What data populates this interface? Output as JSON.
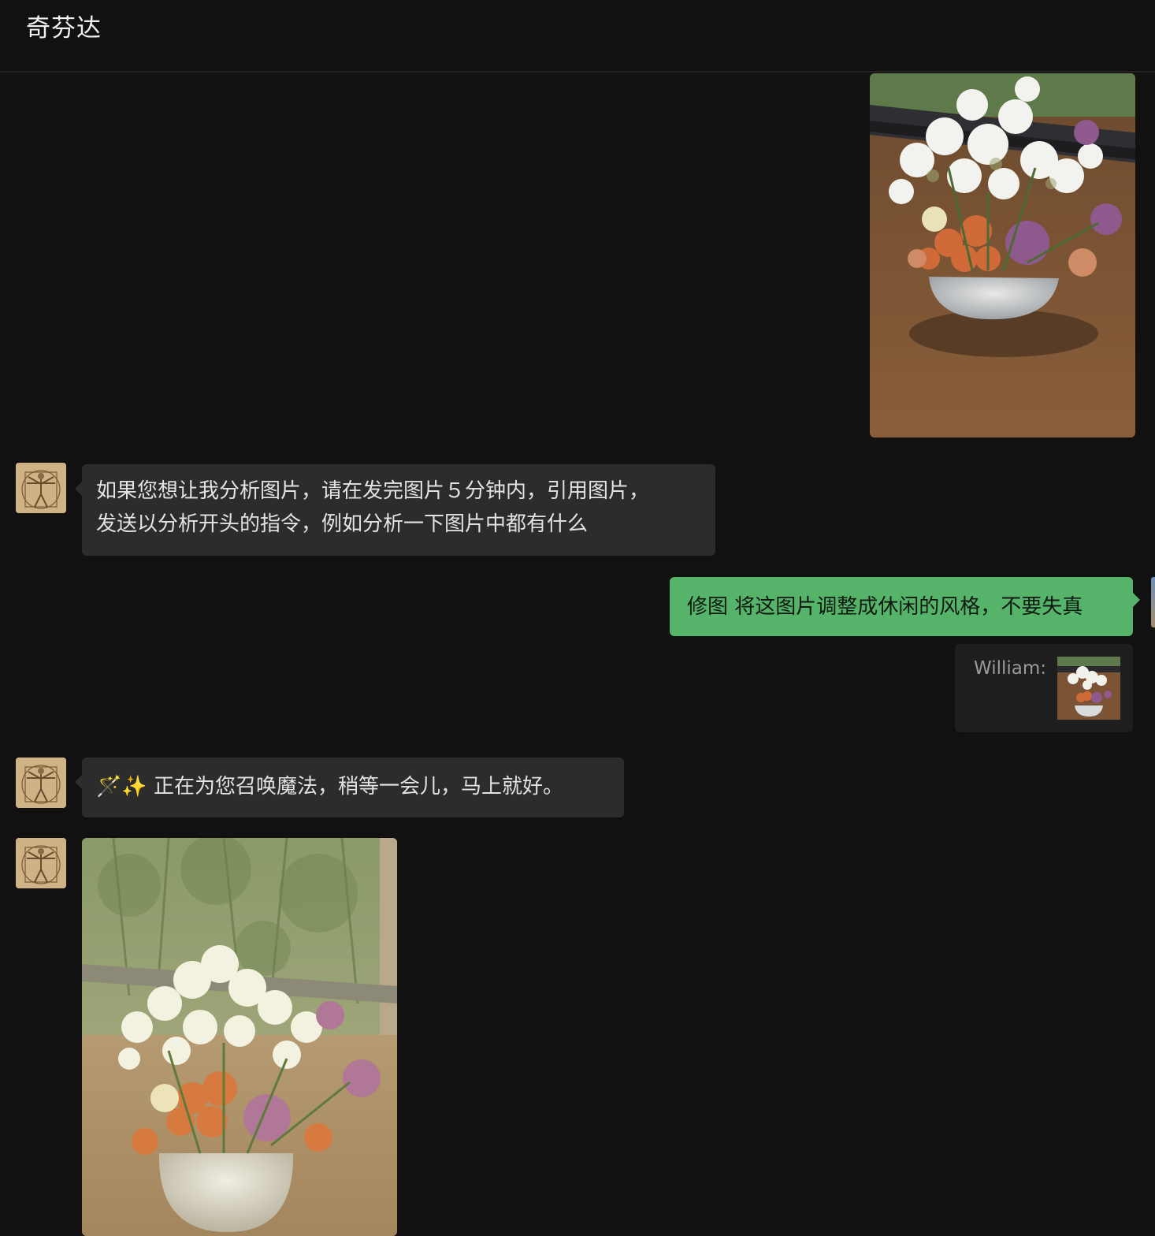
{
  "header": {
    "title": "奇芬达"
  },
  "messages": {
    "bot_reply_1": {
      "line1": "如果您想让我分析图片，请在发完图片５分钟内，引用图片，",
      "line2": "发送以分析开头的指令，例如分析一下图片中都有什么"
    },
    "user_command": {
      "text": "修图 将这图片调整成休闲的风格，不要失真"
    },
    "quote": {
      "sender": "William:"
    },
    "bot_reply_2": {
      "text": "🪄✨ 正在为您召唤魔法，稍等一会儿，马上就好。"
    }
  },
  "colors": {
    "background": "#111111",
    "bubble_dark": "#2c2c2c",
    "bubble_green": "#55b46a",
    "quote_bg": "#1e1e1e"
  },
  "icons": {
    "bot_avatar": "vitruvian-man-avatar-icon"
  }
}
